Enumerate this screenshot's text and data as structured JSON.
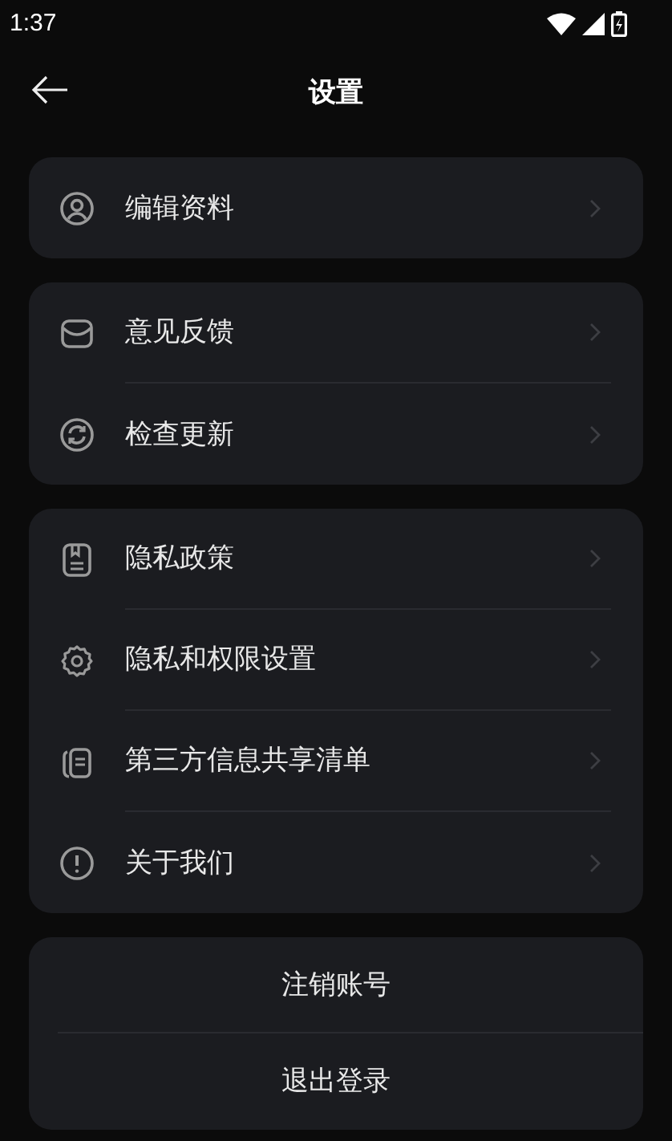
{
  "status_bar": {
    "time": "1:37"
  },
  "header": {
    "title": "设置"
  },
  "groups": [
    {
      "items": [
        {
          "label": "编辑资料"
        }
      ]
    },
    {
      "items": [
        {
          "label": "意见反馈"
        },
        {
          "label": "检查更新"
        }
      ]
    },
    {
      "items": [
        {
          "label": "隐私政策"
        },
        {
          "label": "隐私和权限设置"
        },
        {
          "label": "第三方信息共享清单"
        },
        {
          "label": "关于我们"
        }
      ]
    }
  ],
  "account_actions": [
    {
      "label": "注销账号"
    },
    {
      "label": "退出登录"
    }
  ]
}
